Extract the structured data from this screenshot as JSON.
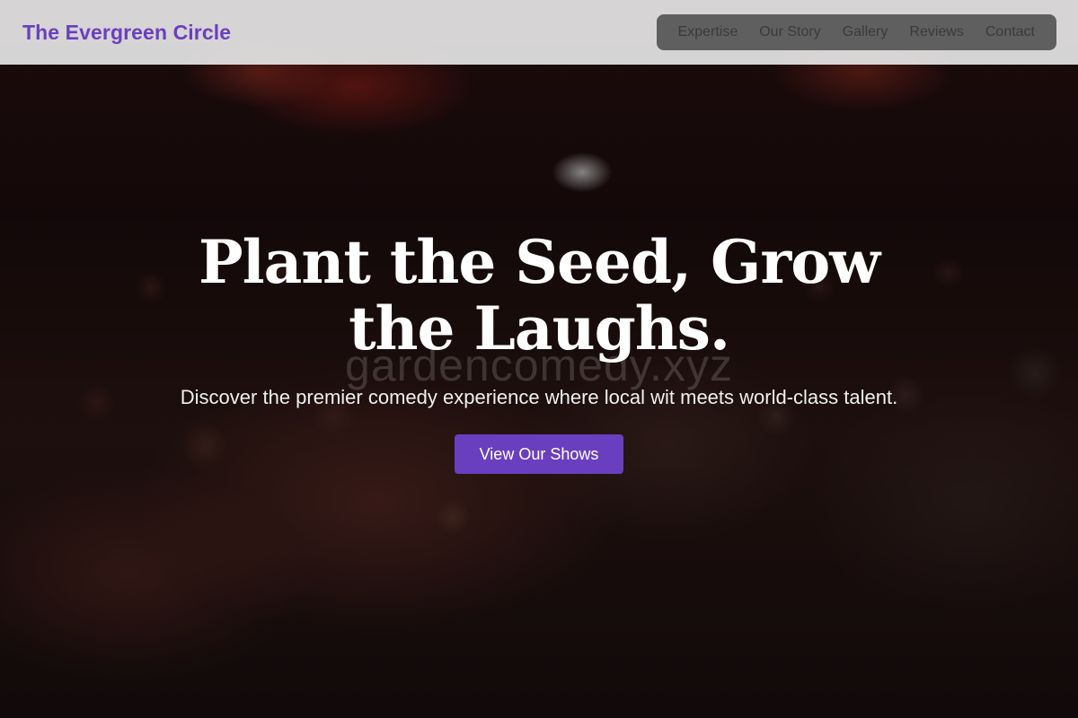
{
  "brand": {
    "name": "The Evergreen Circle",
    "color": "#6a3fbf"
  },
  "nav": {
    "links": [
      {
        "label": "Expertise"
      },
      {
        "label": "Our Story"
      },
      {
        "label": "Gallery"
      },
      {
        "label": "Reviews"
      },
      {
        "label": "Contact"
      }
    ]
  },
  "hero": {
    "title": "Plant the Seed, Grow the Laughs.",
    "subtitle": "Discover the premier comedy experience where local wit meets world-class talent.",
    "cta_label": "View Our Shows",
    "background_image": "concert-crowd-photo",
    "watermark": "gardencomedy.xyz"
  },
  "colors": {
    "accent": "#6a3fbf",
    "navbar_bg": "#e4e4e4",
    "nav_pill_bg": "#555555"
  }
}
